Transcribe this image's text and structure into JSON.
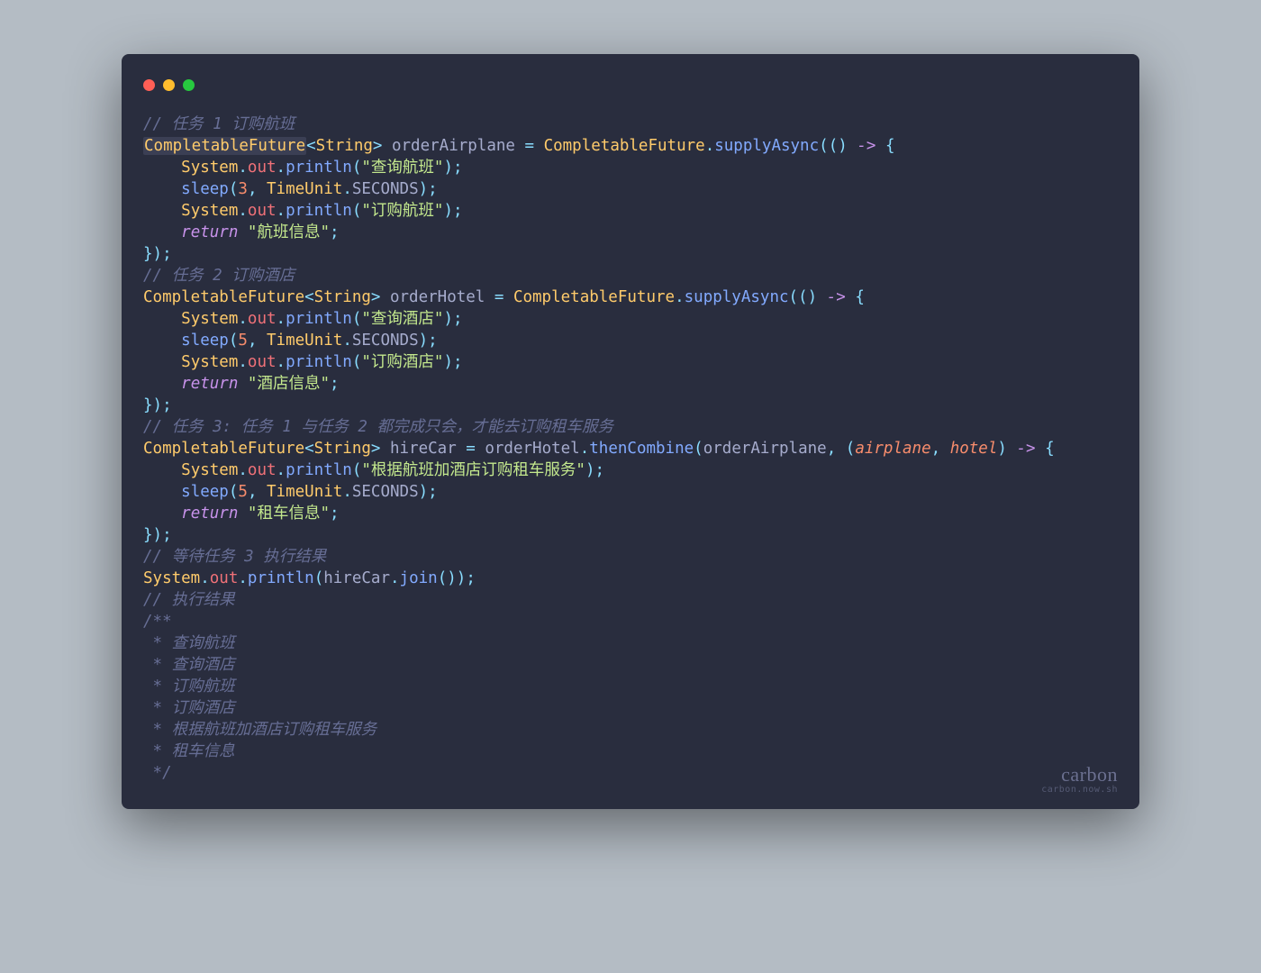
{
  "colors": {
    "page_bg": "#b4bcc4",
    "editor_bg": "#292d3e",
    "dot_red": "#ff5f56",
    "dot_yellow": "#ffbd2e",
    "dot_green": "#27c93f",
    "comment": "#676e95",
    "type": "#ffcb6b",
    "punct": "#89ddff",
    "var": "#a6accd",
    "method": "#82aaff",
    "field": "#f07178",
    "string": "#c3e88d",
    "number": "#f78c6c",
    "keyword": "#c792ea",
    "param": "#f78c6c"
  },
  "watermark": {
    "brand": "carbon",
    "sub": "carbon.now.sh"
  },
  "code": {
    "lang": "java",
    "tokens": {
      "cm1": "// 任务 1 订购航班",
      "cm2": "// 任务 2 订购酒店",
      "cm3": "// 任务 3: 任务 1 与任务 2 都完成只会，才能去订购租车服务",
      "cm4": "// 等待任务 3 执行结果",
      "cm5": "// 执行结果",
      "cm6a": "/**",
      "cm6b": " * 查询航班",
      "cm6c": " * 查询酒店",
      "cm6d": " * 订购航班",
      "cm6e": " * 订购酒店",
      "cm6f": " * 根据航班加酒店订购租车服务",
      "cm6g": " * 租车信息",
      "cm6h": " */",
      "t_cf": "CompletableFuture",
      "t_str": "String",
      "t_sys": "System",
      "t_tu": "TimeUnit",
      "f_out": "out",
      "c_sec": "SECONDS",
      "m_supplyAsync": "supplyAsync",
      "m_println": "println",
      "m_sleep": "sleep",
      "m_thenCombine": "thenCombine",
      "m_join": "join",
      "v_orderAirplane": "orderAirplane",
      "v_orderHotel": "orderHotel",
      "v_hireCar": "hireCar",
      "p_airplane": "airplane",
      "p_hotel": "hotel",
      "kw_return": "return",
      "n3": "3",
      "n5": "5",
      "s_queryFlight": "\"查询航班\"",
      "s_bookFlight": "\"订购航班\"",
      "s_flightInfo": "\"航班信息\"",
      "s_queryHotel": "\"查询酒店\"",
      "s_bookHotel": "\"订购酒店\"",
      "s_hotelInfo": "\"酒店信息\"",
      "s_rentCarMsg": "\"根据航班加酒店订购租车服务\"",
      "s_rentCarInfo": "\"租车信息\"",
      "p_lt": "<",
      "p_gt": ">",
      "p_sp": " ",
      "p_eq": " = ",
      "p_dot": ".",
      "p_lp": "(",
      "p_rp": ")",
      "p_cm": ", ",
      "p_lb": "{",
      "p_rb": "}",
      "p_sc": ";",
      "p_arrow": " -> ",
      "p_rbsc": "});"
    }
  }
}
